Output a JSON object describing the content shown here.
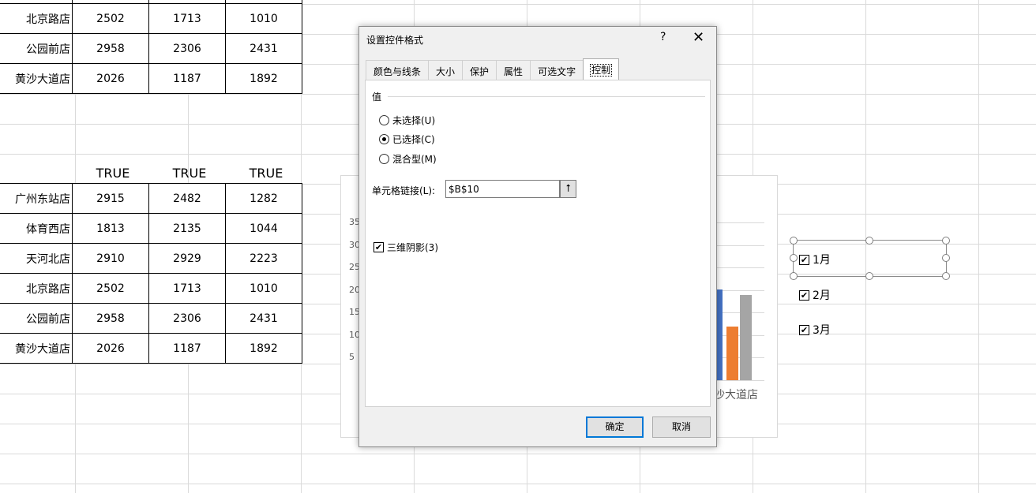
{
  "table_top": {
    "rows": [
      {
        "name": "北京路店",
        "v1": "2502",
        "v2": "1713",
        "v3": "1010"
      },
      {
        "name": "公园前店",
        "v1": "2958",
        "v2": "2306",
        "v3": "2431"
      },
      {
        "name": "黄沙大道店",
        "v1": "2026",
        "v2": "1187",
        "v3": "1892"
      }
    ]
  },
  "flags": [
    "TRUE",
    "TRUE",
    "TRUE"
  ],
  "table_bottom": {
    "rows": [
      {
        "name": "广州东站店",
        "v1": "2915",
        "v2": "2482",
        "v3": "1282"
      },
      {
        "name": "体育西店",
        "v1": "1813",
        "v2": "2135",
        "v3": "1044"
      },
      {
        "name": "天河北店",
        "v1": "2910",
        "v2": "2929",
        "v3": "2223"
      },
      {
        "name": "北京路店",
        "v1": "2502",
        "v2": "1713",
        "v3": "1010"
      },
      {
        "name": "公园前店",
        "v1": "2958",
        "v2": "2306",
        "v3": "2431"
      },
      {
        "name": "黄沙大道店",
        "v1": "2026",
        "v2": "1187",
        "v3": "1892"
      }
    ]
  },
  "chart": {
    "y_ticks": [
      "35",
      "30",
      "25",
      "20",
      "15",
      "10",
      "5"
    ],
    "visible_category": "沙大道店",
    "bars": {
      "blue": 2026,
      "orange": 1187,
      "gray": 1892
    },
    "colors": {
      "blue": "#4472c4",
      "orange": "#ed7d31",
      "gray": "#a5a5a5"
    }
  },
  "checkboxes": [
    {
      "label": "1月",
      "checked": "✔"
    },
    {
      "label": "2月",
      "checked": "✔"
    },
    {
      "label": "3月",
      "checked": "✔"
    }
  ],
  "dialog": {
    "title": "设置控件格式",
    "help": "?",
    "close": "✕",
    "tabs": [
      "颜色与线条",
      "大小",
      "保护",
      "属性",
      "可选文字",
      "控制"
    ],
    "active_tab": "控制",
    "group_label": "值",
    "radios": [
      "未选择(U)",
      "已选择(C)",
      "混合型(M)"
    ],
    "selected_radio": "已选择(C)",
    "cell_link_label": "单元格链接(L):",
    "cell_link_value": "$B$10",
    "cell_link_btn": "⭡",
    "shading_label": "三维阴影(3)",
    "shading_checked": "✔",
    "ok": "确定",
    "cancel": "取消"
  }
}
